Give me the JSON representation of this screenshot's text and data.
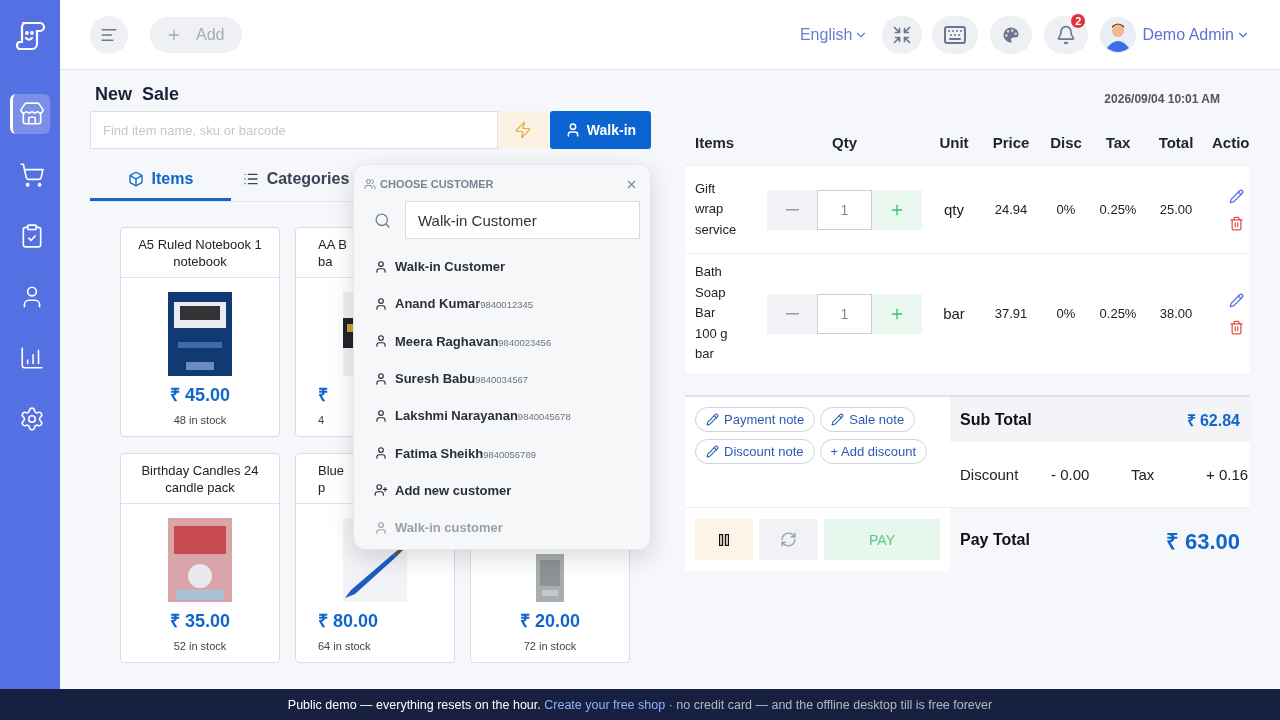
{
  "sidebar": {
    "items": [
      {
        "selected": true
      },
      {
        "selected": false
      },
      {
        "selected": false
      },
      {
        "selected": false
      },
      {
        "selected": false
      },
      {
        "selected": false
      }
    ]
  },
  "header": {
    "add_label": "Add",
    "language": "English",
    "notification_count": "2",
    "user_name": "Demo Admin"
  },
  "sale": {
    "title": "New  Sale",
    "search": {
      "placeholder": "Find item name, sku or barcode"
    },
    "customer_button": "Walk-in",
    "tabs": [
      {
        "label": "Items",
        "selected": true
      },
      {
        "label": "Categories",
        "selected": false
      }
    ],
    "products": [
      [
        {
          "title_lines": [
            "A5 Ruled Notebook 1",
            "notebook"
          ],
          "price": "₹ 45.00",
          "stock": "48 in stock",
          "partial": false
        },
        {
          "title_lines": [
            "AA B",
            "ba"
          ],
          "price": "₹",
          "stock": "4",
          "partial": true
        }
      ],
      [
        {
          "title_lines": [
            "Birthday Candles 24",
            "candle pack"
          ],
          "price": "₹ 35.00",
          "stock": "52 in stock",
          "partial": false
        },
        {
          "title_lines": [
            "Blue",
            "p"
          ],
          "price": "₹ 80.00",
          "stock": "64 in stock",
          "partial": true
        },
        {
          "price": "₹ 20.00",
          "stock": "72 in stock"
        }
      ]
    ]
  },
  "customer_popup": {
    "title": "CHOOSE CUSTOMER",
    "search": {
      "value": "Walk-in Customer"
    },
    "options": [
      {
        "kind": "customer",
        "name": "Walk-in Customer",
        "disabled": false
      },
      {
        "kind": "customer",
        "name": "Anand Kumar",
        "phone": "9840012345",
        "disabled": false
      },
      {
        "kind": "customer",
        "name": "Meera Raghavan",
        "phone": "9840023456",
        "disabled": false
      },
      {
        "kind": "customer",
        "name": "Suresh Babu",
        "phone": "9840034567",
        "disabled": false
      },
      {
        "kind": "customer",
        "name": "Lakshmi Narayanan",
        "phone": "9840045678",
        "disabled": false
      },
      {
        "kind": "customer",
        "name": "Fatima Sheikh",
        "phone": "9840056789",
        "disabled": false
      },
      {
        "kind": "add",
        "name": "Add new customer",
        "disabled": false
      },
      {
        "kind": "customer",
        "name": "Walk-in customer",
        "disabled": true
      }
    ]
  },
  "cart": {
    "date": "2026/09/04 10:01 AM",
    "columns": [
      "Items",
      "Qty",
      "Unit",
      "Price",
      "Disc",
      "Tax",
      "Total",
      "Actio"
    ],
    "rows": [
      {
        "name": "Gift wrap service",
        "qty": "1",
        "unit": "qty",
        "price": "24.94",
        "disc": "0%",
        "tax": "0.25%",
        "total": "25.00"
      },
      {
        "name": "Bath Soap Bar 100 g bar",
        "qty": "1",
        "unit": "bar",
        "price": "37.91",
        "disc": "0%",
        "tax": "0.25%",
        "total": "38.00"
      }
    ],
    "notes": [
      "Payment note",
      "Sale note",
      "Discount note"
    ],
    "add_discount": "+ Add discount",
    "subtotal": {
      "label": "Sub Total",
      "value": "₹ 62.84"
    },
    "discount": {
      "label": "Discount",
      "value": "- 0.00"
    },
    "tax": {
      "label": "Tax",
      "value": "+ 0.16"
    },
    "pay_label": "PAY",
    "pay_total": {
      "label": "Pay Total",
      "value": "₹ 63.00"
    }
  },
  "footer": {
    "before": "Public demo — everything resets on the hour.",
    "link": "Create your free shop",
    "after": "· no credit card — and the offline desktop till is free forever"
  }
}
